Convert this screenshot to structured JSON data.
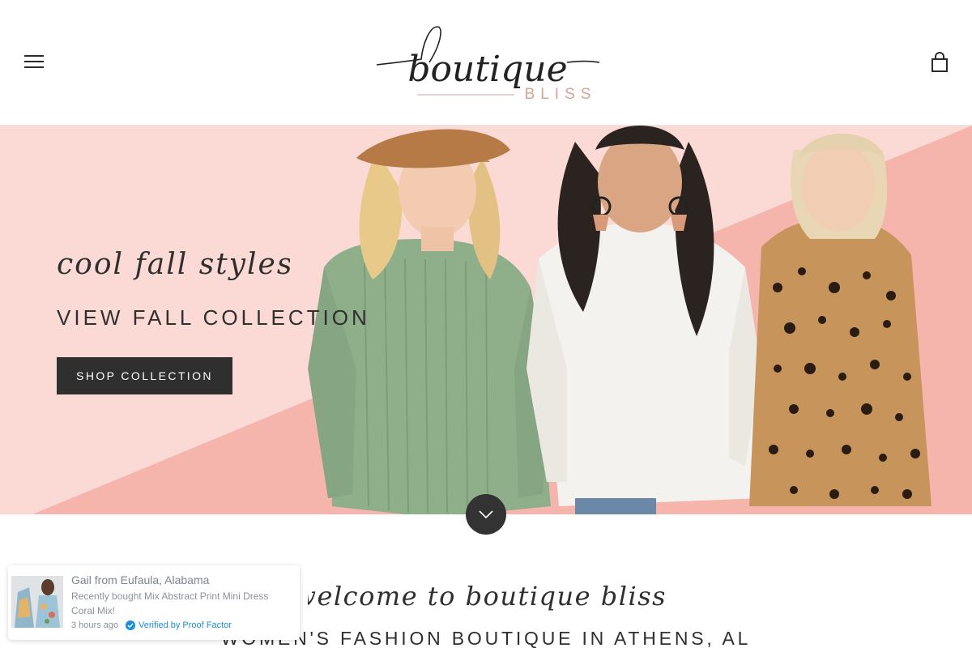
{
  "header": {
    "menu_icon": "hamburger-menu-icon",
    "logo": {
      "script": "boutique",
      "word": "BLISS"
    },
    "cart_icon": "shopping-bag-icon"
  },
  "hero": {
    "script_text": "cool fall styles",
    "heading": "VIEW FALL COLLECTION",
    "button_label": "SHOP COLLECTION",
    "scroll_icon": "chevron-down-icon",
    "background_color": "#fbdad6",
    "accent_color": "#f5b4ac"
  },
  "welcome": {
    "script_text": "welcome to boutique bliss!",
    "heading": "WOMEN'S FASHION BOUTIQUE IN ATHENS, AL"
  },
  "proof_popup": {
    "name": "Gail from Eufaula, Alabama",
    "message": "Recently bought Mix Abstract Print Mini Dress Coral Mix!",
    "time": "3 hours ago",
    "verified": "Verified by Proof Factor",
    "verified_color": "#1a8fe0"
  }
}
